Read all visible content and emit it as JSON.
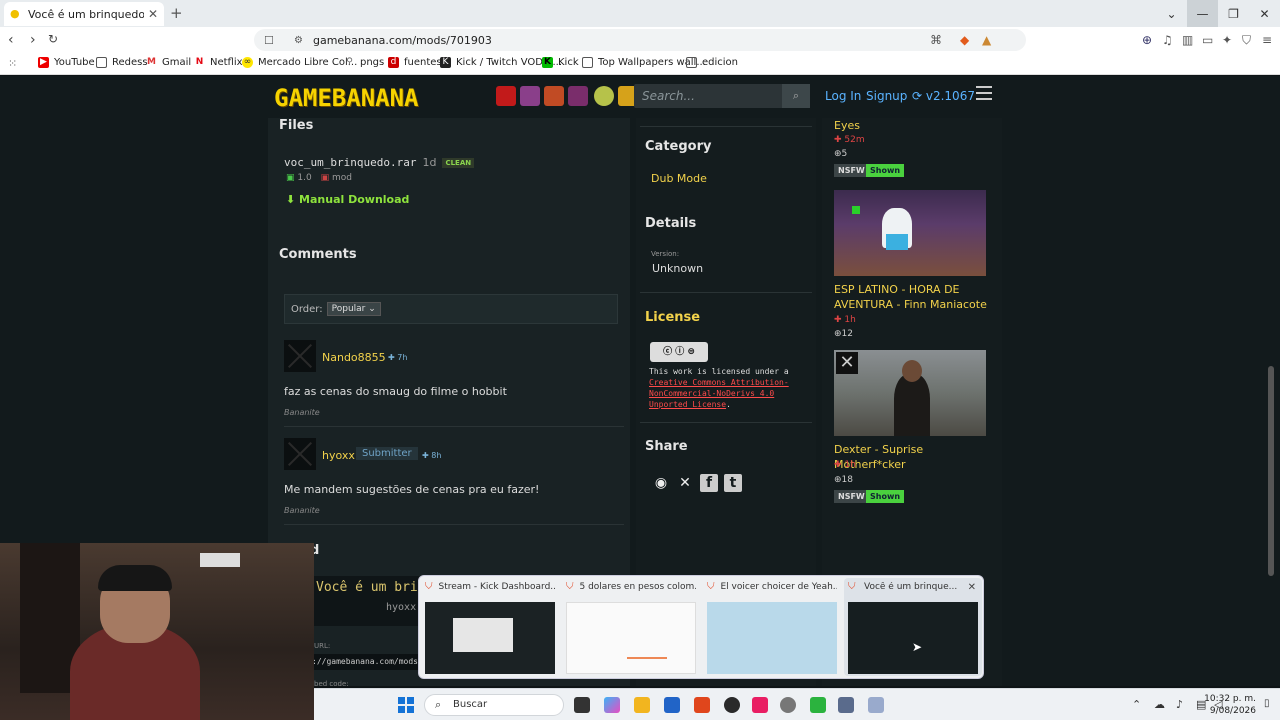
{
  "browser": {
    "tab_title": "Você é um brinquedo! (DUB PT",
    "url": "gamebanana.com/mods/701903",
    "bookmarks": [
      "YouTube",
      "Redess",
      "Gmail",
      "Netflix",
      "Mercado Libre Col...",
      "pngs",
      "fuentes",
      "Kick / Twitch VOD d...",
      "Kick",
      "Top Wallpapers wall...",
      "edicion"
    ]
  },
  "header": {
    "logo": "GAMEBANANA",
    "search_placeholder": "Search...",
    "login": "Log In",
    "signup": "Signup",
    "version": "v2.1067"
  },
  "files": {
    "heading": "Files",
    "filename": "voc_um_brinquedo.rar",
    "age": "1d",
    "clean_badge": "CLEAN",
    "file_version": "1.0",
    "file_type": "mod",
    "download_label": "Manual Download"
  },
  "comments": {
    "heading": "Comments",
    "order_label": "Order:",
    "order_value": "Popular",
    "items": [
      {
        "user": "Nando8855",
        "time": "7h",
        "text": "faz as cenas do smaug do filme o hobbit",
        "rank": "Bananite"
      },
      {
        "user": "hyoxx",
        "badge": "Submitter",
        "time": "8h",
        "text": "Me mandem sugestões de cenas pra eu fazer!",
        "rank": "Bananite"
      }
    ]
  },
  "sidebar": {
    "category_heading": "Category",
    "category_value": "Dub Mode",
    "details_heading": "Details",
    "version_label": "Version:",
    "version_value": "Unknown",
    "license_heading": "License",
    "license_prefix": "This work is licensed under a",
    "license_link": "Creative Commons Attribution-NonCommercial-NoDerivs 4.0 Unported License",
    "license_suffix": ".",
    "share_heading": "Share"
  },
  "related": [
    {
      "title": "Eyes",
      "time": "52m",
      "count": "5",
      "nsfw": "NSFW",
      "shown": "Shown"
    },
    {
      "title": "ESP LATINO - HORA DE AVENTURA - Finn Maniacote",
      "time": "1h",
      "count": "12"
    },
    {
      "title": "Dexter - Suprise Motherf*cker",
      "time": "1h",
      "count": "18",
      "nsfw": "NSFW",
      "shown": "Shown"
    }
  ],
  "behind_fragments": {
    "heading_tail": "d",
    "title_line": "Você é um brin",
    "author": "hyoxx",
    "url_label": "URL:",
    "url_value": "://gamebanana.com/mods/",
    "embed_label": "bed code:"
  },
  "previews": [
    {
      "title": "Stream - Kick Dashboard..."
    },
    {
      "title": "5 dolares en pesos colom..."
    },
    {
      "title": "El voicer choicer de Yeah..."
    },
    {
      "title": "Você é um brinque..."
    }
  ],
  "taskbar": {
    "search_label": "Buscar",
    "time": "10:32 p. m.",
    "date": "9/08/2026"
  }
}
